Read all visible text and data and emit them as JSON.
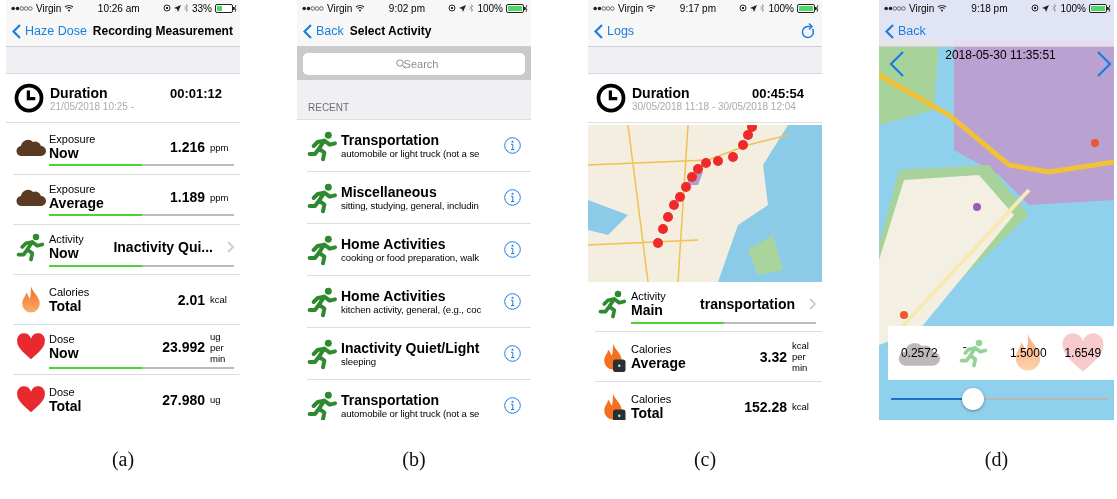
{
  "panels": [
    {
      "caption": "(a)",
      "kind": "measurement",
      "status": {
        "carrier": "Virgin",
        "time": "10:26 am",
        "battery": "33%"
      },
      "nav": {
        "back": "Haze Dose",
        "title": "Recording Measurement"
      },
      "duration": {
        "label": "Duration",
        "value": "00:01:12",
        "range": "21/05/2018 10:25 -"
      },
      "rows": [
        {
          "kind": "cloud",
          "category": "Exposure",
          "label": "Now",
          "value": "1.216",
          "unit": "ppm",
          "level": 0.5,
          "disclosure": false
        },
        {
          "kind": "cloud",
          "category": "Exposure",
          "label": "Average",
          "value": "1.189",
          "unit": "ppm",
          "level": 0.5,
          "disclosure": false
        },
        {
          "kind": "runner",
          "category": "Activity",
          "label": "Now",
          "value": "Inactivity Qui...",
          "level": 0.5,
          "disclosure": true
        },
        {
          "kind": "flame",
          "category": "Calories",
          "label": "Total",
          "value": "2.01",
          "unit": "kcal",
          "disclosure": false
        },
        {
          "kind": "heart",
          "category": "Dose",
          "label": "Now",
          "value": "23.992",
          "unit": "ug per min",
          "level": 0.5,
          "disclosure": false
        },
        {
          "kind": "heart",
          "category": "Dose",
          "label": "Total",
          "value": "27.980",
          "unit": "ug",
          "disclosure": false
        }
      ]
    },
    {
      "caption": "(b)",
      "kind": "activity_list",
      "status": {
        "carrier": "Virgin",
        "time": "9:02 pm",
        "battery": "100%"
      },
      "nav": {
        "back": "Back",
        "title": "Select Activity"
      },
      "search": {
        "placeholder": "Search"
      },
      "section": "RECENT",
      "items": [
        {
          "title": "Transportation",
          "detail": "automobile or light truck (not a se"
        },
        {
          "title": "Miscellaneous",
          "detail": "sitting, studying, general, includin"
        },
        {
          "title": "Home Activities",
          "detail": "cooking or food preparation, walk"
        },
        {
          "title": "Home Activities",
          "detail": "kitchen activity, general, (e.g., coc"
        },
        {
          "title": "Inactivity Quiet/Light",
          "detail": "sleeping"
        },
        {
          "title": "Transportation",
          "detail": "automobile or light truck (not a se"
        }
      ]
    },
    {
      "caption": "(c)",
      "kind": "log",
      "status": {
        "carrier": "Virgin",
        "time": "9:17 pm",
        "battery": "100%"
      },
      "nav": {
        "back": "Logs"
      },
      "duration": {
        "label": "Duration",
        "value": "00:45:54",
        "range": "30/05/2018 11:18 - 30/05/2018 12:04"
      },
      "rows": [
        {
          "kind": "runner",
          "category": "Activity",
          "label": "Main",
          "value": "transportation",
          "level": 0.5,
          "disclosure": true
        },
        {
          "kind": "flame_watch",
          "category": "Calories",
          "label": "Average",
          "value": "3.32",
          "unit": "kcal per min",
          "disclosure": false
        },
        {
          "kind": "flame_watch",
          "category": "Calories",
          "label": "Total",
          "value": "152.28",
          "unit": "kcal",
          "disclosure": false
        }
      ]
    },
    {
      "caption": "(d)",
      "kind": "replay",
      "status": {
        "carrier": "Virgin",
        "time": "9:18 pm",
        "battery": "100%"
      },
      "nav": {
        "back": "Back"
      },
      "timestamp": "2018-05-30 11:35:51",
      "summary": [
        {
          "kind": "cloud",
          "value": "0.2572"
        },
        {
          "kind": "runner",
          "value": "-"
        },
        {
          "kind": "flame",
          "value": "1.5000"
        },
        {
          "kind": "heart",
          "value": "1.6549"
        }
      ],
      "slider": {
        "level": 0.38
      }
    }
  ]
}
